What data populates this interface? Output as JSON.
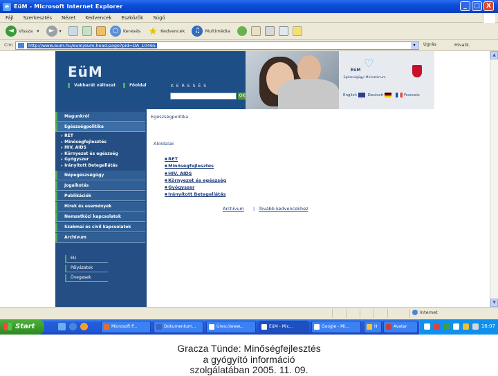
{
  "window": {
    "title": "EüM - Microsoft Internet Explorer",
    "controls": [
      "_",
      "□",
      "X"
    ]
  },
  "menubar": [
    "Fájl",
    "Szerkesztés",
    "Nézet",
    "Kedvencek",
    "Eszközök",
    "Súgó"
  ],
  "toolbar": {
    "back": "Vissza",
    "search": "Keresés",
    "favorites": "Kedvencek",
    "media": "Multimédia"
  },
  "address": {
    "label": "Cím",
    "url": "http://www.eum.hu/eum/eum.head.page?pid=DA_10465",
    "go": "Ugrás",
    "links": "Hivatk."
  },
  "site": {
    "logo": "EüM",
    "nav": [
      "Vakbarát változat",
      "Főoldal"
    ],
    "search_label": "KERESÉS",
    "search_value": "",
    "ok": "OK",
    "brand": "EüM",
    "brand_sub": "Egészségügyi Minisztérium",
    "langs": [
      "English",
      "Deutsch",
      "Francais"
    ]
  },
  "sidebar": {
    "items": [
      "Magunkról",
      "Egészségpolitika"
    ],
    "subitems": [
      "RET",
      "Minőségfejlesztés",
      "HIV, AIDS",
      "Környezet és egészség",
      "Gyógyszer",
      "Irányított Betegellátás"
    ],
    "items2": [
      "Népegészségügy",
      "Jogalkotás",
      "Publikációk",
      "Hírek és események",
      "Nemzetközi kapcsolatok",
      "Szakmai és civil kapcsolatok",
      "Archívum"
    ],
    "lower": [
      "EU",
      "Pályázatok",
      "Övegesek"
    ]
  },
  "content": {
    "breadcrumb": "Egészségpolitika",
    "section_title": "Aloldalak",
    "links": [
      "RET",
      "Minőségfejlesztés",
      "HIV, AIDS",
      "Környezet és egészség",
      "Gyógyszer",
      "Irányított Betegellátás"
    ],
    "archive": "Archívum",
    "separator": "|",
    "favorite": "Tovább kedvencekhez"
  },
  "statusbar": {
    "zone": "Internet"
  },
  "taskbar": {
    "start": "Start",
    "tasks": [
      "Microsoft P...",
      "Dokumentum...",
      "Üres://www...",
      "EüM - Mic...",
      "Google - Mi...",
      "H",
      "Avatar"
    ],
    "clock": "16:07"
  },
  "caption": {
    "line1": "Gracza Tünde: Minőségfejlesztés",
    "line2": "a gyógyító információ",
    "line3": "szolgálatában 2005. 11. 09."
  }
}
